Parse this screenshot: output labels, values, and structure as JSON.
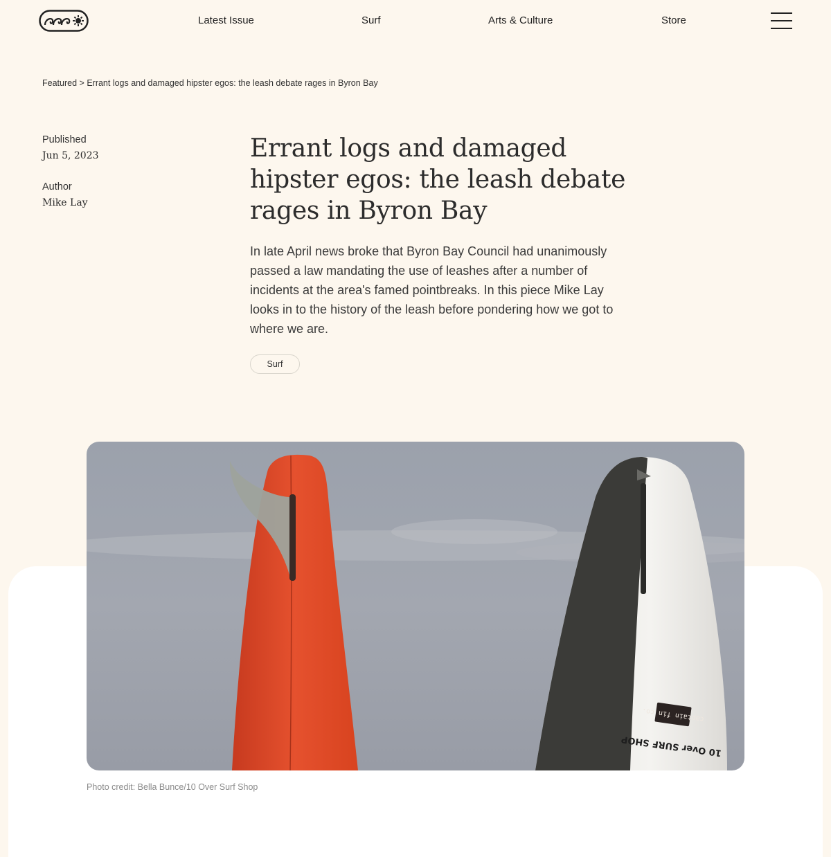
{
  "nav": {
    "logo_alt": "Magazine logo",
    "links": [
      "Latest Issue",
      "Surf",
      "Arts & Culture",
      "Store"
    ]
  },
  "breadcrumb": {
    "section": "Featured",
    "separator": ">",
    "current": "Errant logs and damaged hipster egos: the leash debate rages in Byron Bay"
  },
  "meta": {
    "published_label": "Published",
    "published_date": "Jun 5, 2023",
    "author_label": "Author",
    "author_name": "Mike Lay"
  },
  "article": {
    "title": "Errant logs and damaged hipster egos: the leash debate rages in Byron Bay",
    "summary": "In late April news broke that Byron Bay Council had unanimously passed a law mandating the use of leashes after a number of incidents at the area's famed pointbreaks. In this piece Mike Lay looks in to the history of the leash before pondering how we got to where we are.",
    "tag": "Surf"
  },
  "hero": {
    "board_stickers": [
      "captain fin co.",
      "10 Over SURF SHOP"
    ],
    "photo_credit": "Photo credit: Bella Bunce/10 Over Surf Shop"
  },
  "colors": {
    "background": "#fdf7ee",
    "sky": "#9aa0ab",
    "red_board": "#e0482a"
  }
}
